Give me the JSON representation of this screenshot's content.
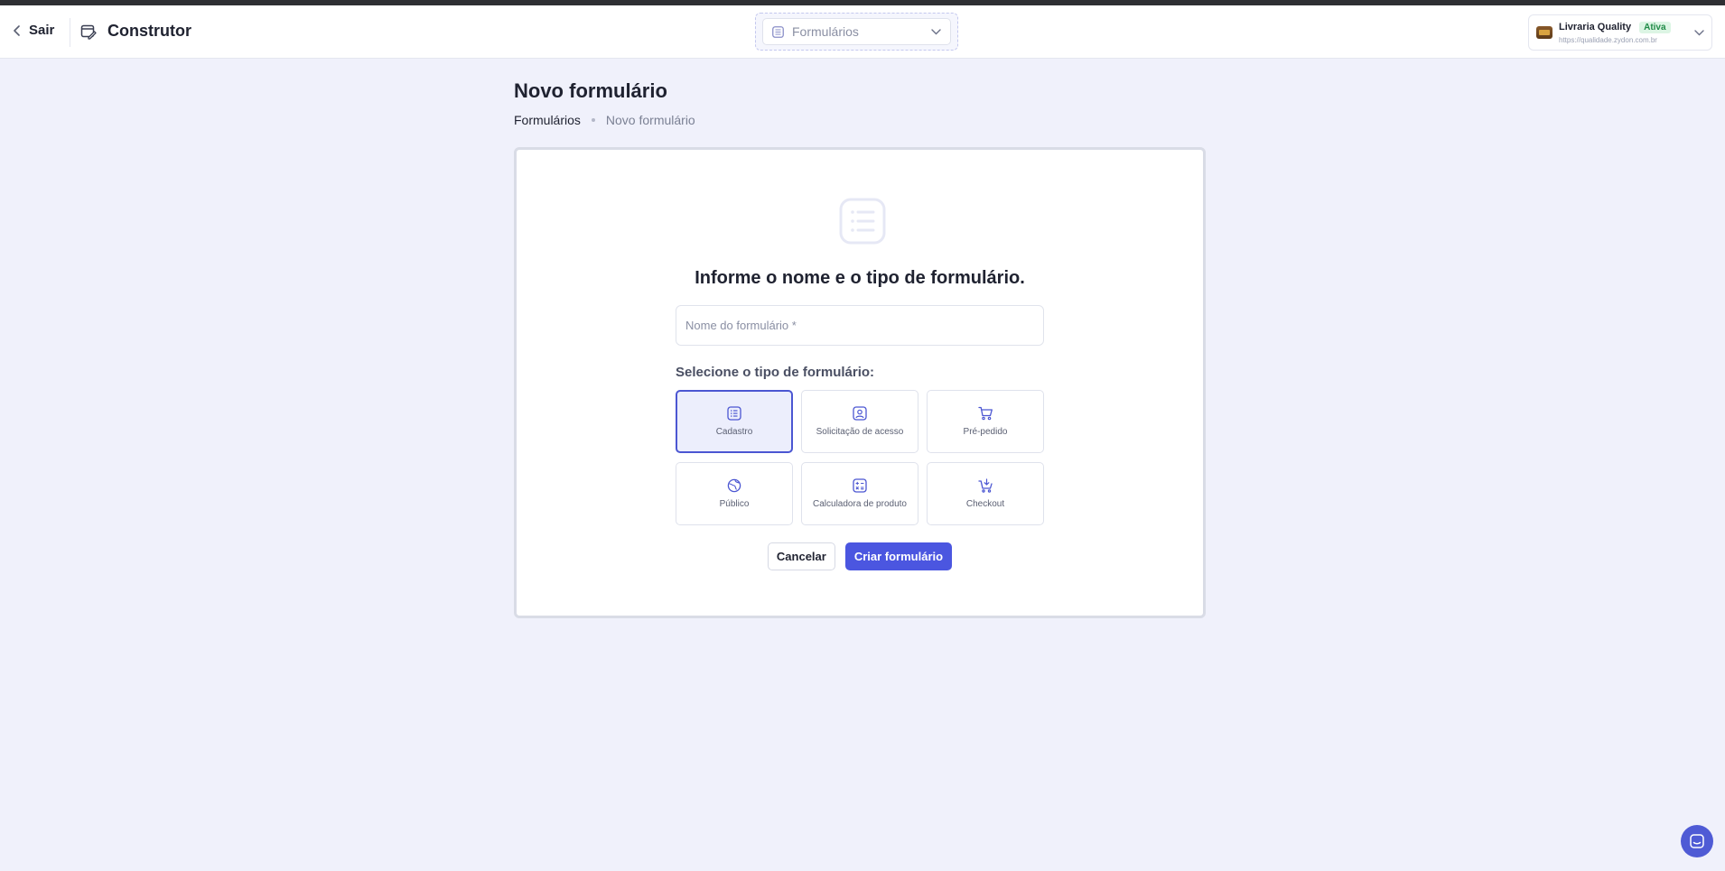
{
  "header": {
    "exit_label": "Sair",
    "app_title": "Construtor",
    "section_select": {
      "value": "Formulários"
    },
    "store": {
      "name": "Livraria Quality",
      "status": "Ativa",
      "url": "https://qualidade.zydon.com.br"
    }
  },
  "page": {
    "title": "Novo formulário",
    "breadcrumb": [
      "Formulários",
      "Novo formulário"
    ]
  },
  "form": {
    "heading": "Informe o nome e o tipo de formulário.",
    "name_placeholder": "Nome do formulário *",
    "name_value": "",
    "type_label": "Selecione o tipo de formulário:",
    "types": [
      {
        "label": "Cadastro",
        "icon": "list-icon",
        "selected": true
      },
      {
        "label": "Solicitação de acesso",
        "icon": "user-badge-icon",
        "selected": false
      },
      {
        "label": "Pré-pedido",
        "icon": "cart-icon",
        "selected": false
      },
      {
        "label": "Público",
        "icon": "globe-icon",
        "selected": false
      },
      {
        "label": "Calculadora de produto",
        "icon": "calculator-icon",
        "selected": false
      },
      {
        "label": "Checkout",
        "icon": "cart-plus-icon",
        "selected": false
      }
    ],
    "cancel_label": "Cancelar",
    "submit_label": "Criar formulário"
  },
  "colors": {
    "accent": "#4b56e0",
    "page_bg": "#f0f1fb",
    "status_badge": "#1f8a46"
  }
}
